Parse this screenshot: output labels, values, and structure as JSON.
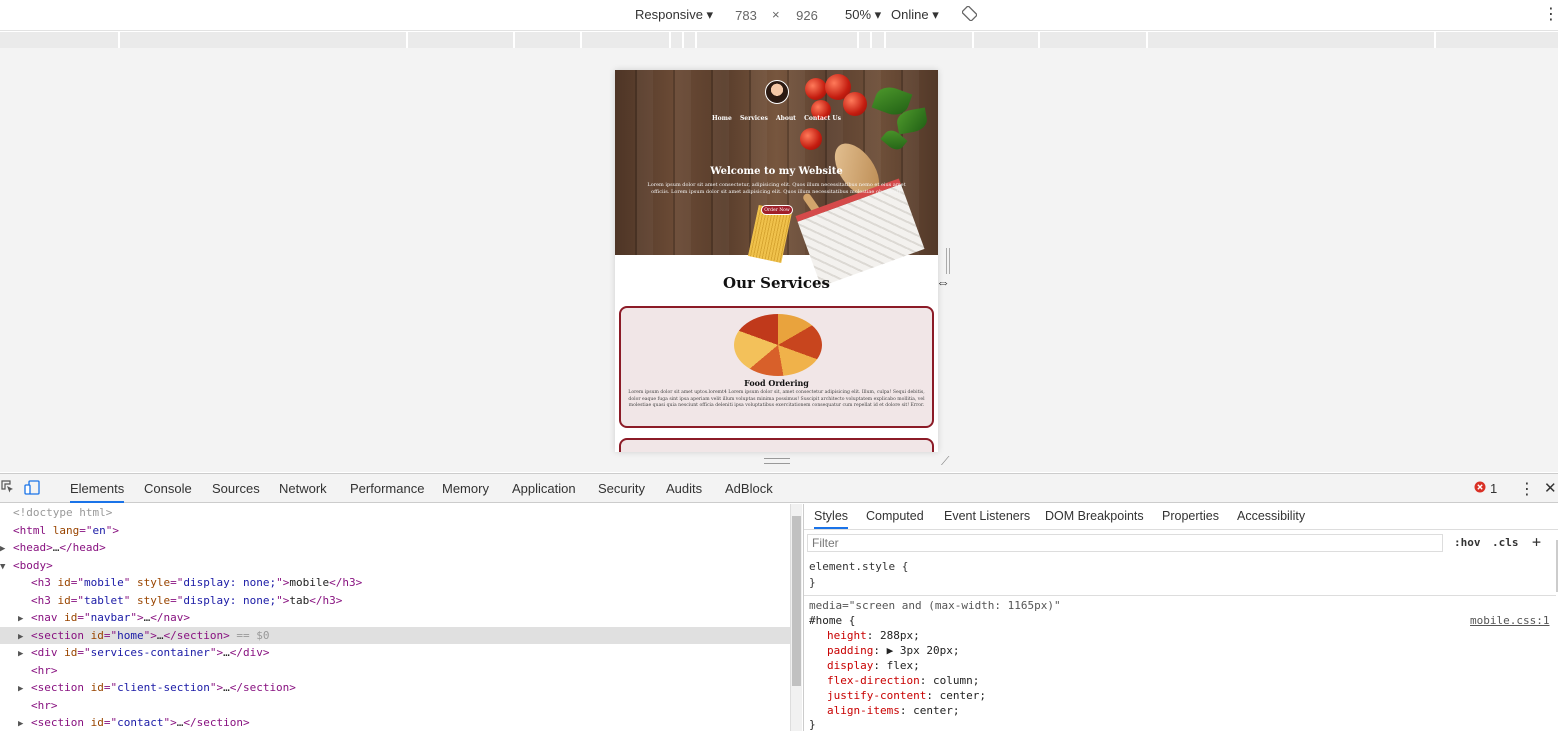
{
  "toolbar": {
    "device": "Responsive ▾",
    "width": "783",
    "x": "×",
    "height": "926",
    "zoom": "50% ▾",
    "network": "Online ▾",
    "rotate_icon": "rotate-icon",
    "more": "⋮"
  },
  "site": {
    "nav": [
      "Home",
      "Services",
      "About",
      "Contact Us"
    ],
    "welcome": "Welcome to my Website",
    "lorem": "Lorem ipsum dolor sit amet consectetur, adipisicing elit. Quos illum necessitatibus nemo et eius amet officiis. Lorem ipsum dolor sit amet adipisicing elit. Quos illum necessitatibus molestiae obcaecati.",
    "order_button": "Order Now",
    "services_title": "Our Services",
    "card_title": "Food Ordering",
    "card_text": "Lorem ipsum dolor sit amet uptos.loremt4 Lorem ipsum dolor sit, amet consectetur adipisicing elit. Illum, culpa! Sequi debitis, dolor eaque fuga sint ipsa aperiam velit illum voluptas minima possimus! Suscipit architecto voluptatem explicabo mollitia, vel molestiae quasi quia nesciunt officia deleniti ipsa voluptatibus exercitationem consequatur cum repellat id et dolore sit! Error."
  },
  "devtools_tabs": [
    "Elements",
    "Console",
    "Sources",
    "Network",
    "Performance",
    "Memory",
    "Application",
    "Security",
    "Audits",
    "AdBlock"
  ],
  "error_count": "1",
  "dom": [
    {
      "indent": 0,
      "tri": "",
      "html": "<!doctype html>",
      "type": "cmt"
    },
    {
      "indent": 0,
      "tri": "",
      "open": "html",
      "attrs": [
        [
          "lang",
          "en"
        ]
      ],
      "close": false
    },
    {
      "indent": 0,
      "tri": "▶",
      "open": "head",
      "attrs": [],
      "ellipsis": true
    },
    {
      "indent": 0,
      "tri": "▼",
      "open": "body",
      "attrs": []
    },
    {
      "indent": 1,
      "tri": "",
      "open": "h3",
      "attrs": [
        [
          "id",
          "mobile"
        ],
        [
          "style",
          "display: none;"
        ]
      ],
      "text": "mobile"
    },
    {
      "indent": 1,
      "tri": "",
      "open": "h3",
      "attrs": [
        [
          "id",
          "tablet"
        ],
        [
          "style",
          "display: none;"
        ]
      ],
      "text": "tab"
    },
    {
      "indent": 1,
      "tri": "▶",
      "open": "nav",
      "attrs": [
        [
          "id",
          "navbar"
        ]
      ],
      "ellipsis": true
    },
    {
      "indent": 1,
      "tri": "▶",
      "open": "section",
      "attrs": [
        [
          "id",
          "home"
        ]
      ],
      "ellipsis": true,
      "selected": true,
      "suffix": " == $0"
    },
    {
      "indent": 1,
      "tri": "▶",
      "open": "div",
      "attrs": [
        [
          "id",
          "services-container"
        ]
      ],
      "ellipsis": true
    },
    {
      "indent": 1,
      "tri": "",
      "open": "hr",
      "attrs": [],
      "void": true
    },
    {
      "indent": 1,
      "tri": "▶",
      "open": "section",
      "attrs": [
        [
          "id",
          "client-section"
        ]
      ],
      "ellipsis": true
    },
    {
      "indent": 1,
      "tri": "",
      "open": "hr",
      "attrs": [],
      "void": true
    },
    {
      "indent": 1,
      "tri": "▶",
      "open": "section",
      "attrs": [
        [
          "id",
          "contact"
        ]
      ],
      "ellipsis": true
    }
  ],
  "styles_tabs": [
    "Styles",
    "Computed",
    "Event Listeners",
    "DOM Breakpoints",
    "Properties",
    "Accessibility"
  ],
  "filter_placeholder": "Filter",
  "hov": ":hov",
  "cls": ".cls",
  "plus": "+",
  "element_style": "element.style {",
  "element_style_close": "}",
  "media": "media=\"screen and (max-width: 1165px)\"",
  "selector": "#home {",
  "source": "mobile.css:1",
  "rules": [
    {
      "prop": "height",
      "value": "288px;"
    },
    {
      "prop": "padding",
      "value": "▶ 3px 20px;"
    },
    {
      "prop": "display",
      "value": "flex;"
    },
    {
      "prop": "flex-direction",
      "value": "column;"
    },
    {
      "prop": "justify-content",
      "value": "center;"
    },
    {
      "prop": "align-items",
      "value": "center;"
    }
  ],
  "rules_close": "}"
}
